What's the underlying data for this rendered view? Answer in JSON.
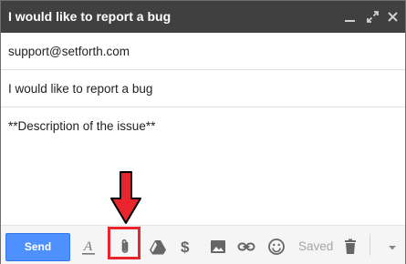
{
  "window": {
    "title": "I would like to report a bug",
    "controls": [
      "minimize-icon",
      "expand-icon",
      "close-icon"
    ]
  },
  "compose": {
    "to": "support@setforth.com",
    "subject": "I would like to report a bug",
    "body": "**Description of the issue**"
  },
  "toolbar": {
    "send_label": "Send",
    "saved_label": "Saved",
    "tools": [
      "formatting-icon",
      "attach-file-icon",
      "drive-icon",
      "money-icon",
      "photo-icon",
      "link-icon",
      "emoji-icon",
      "trash-icon",
      "more-options-icon"
    ]
  },
  "annotation": {
    "highlight_target": "attach-file-icon",
    "highlight_color": "#e8252d"
  },
  "colors": {
    "titlebar": "#404040",
    "send_button": "#4d90fe",
    "toolbar_bg": "#f5f5f5"
  }
}
